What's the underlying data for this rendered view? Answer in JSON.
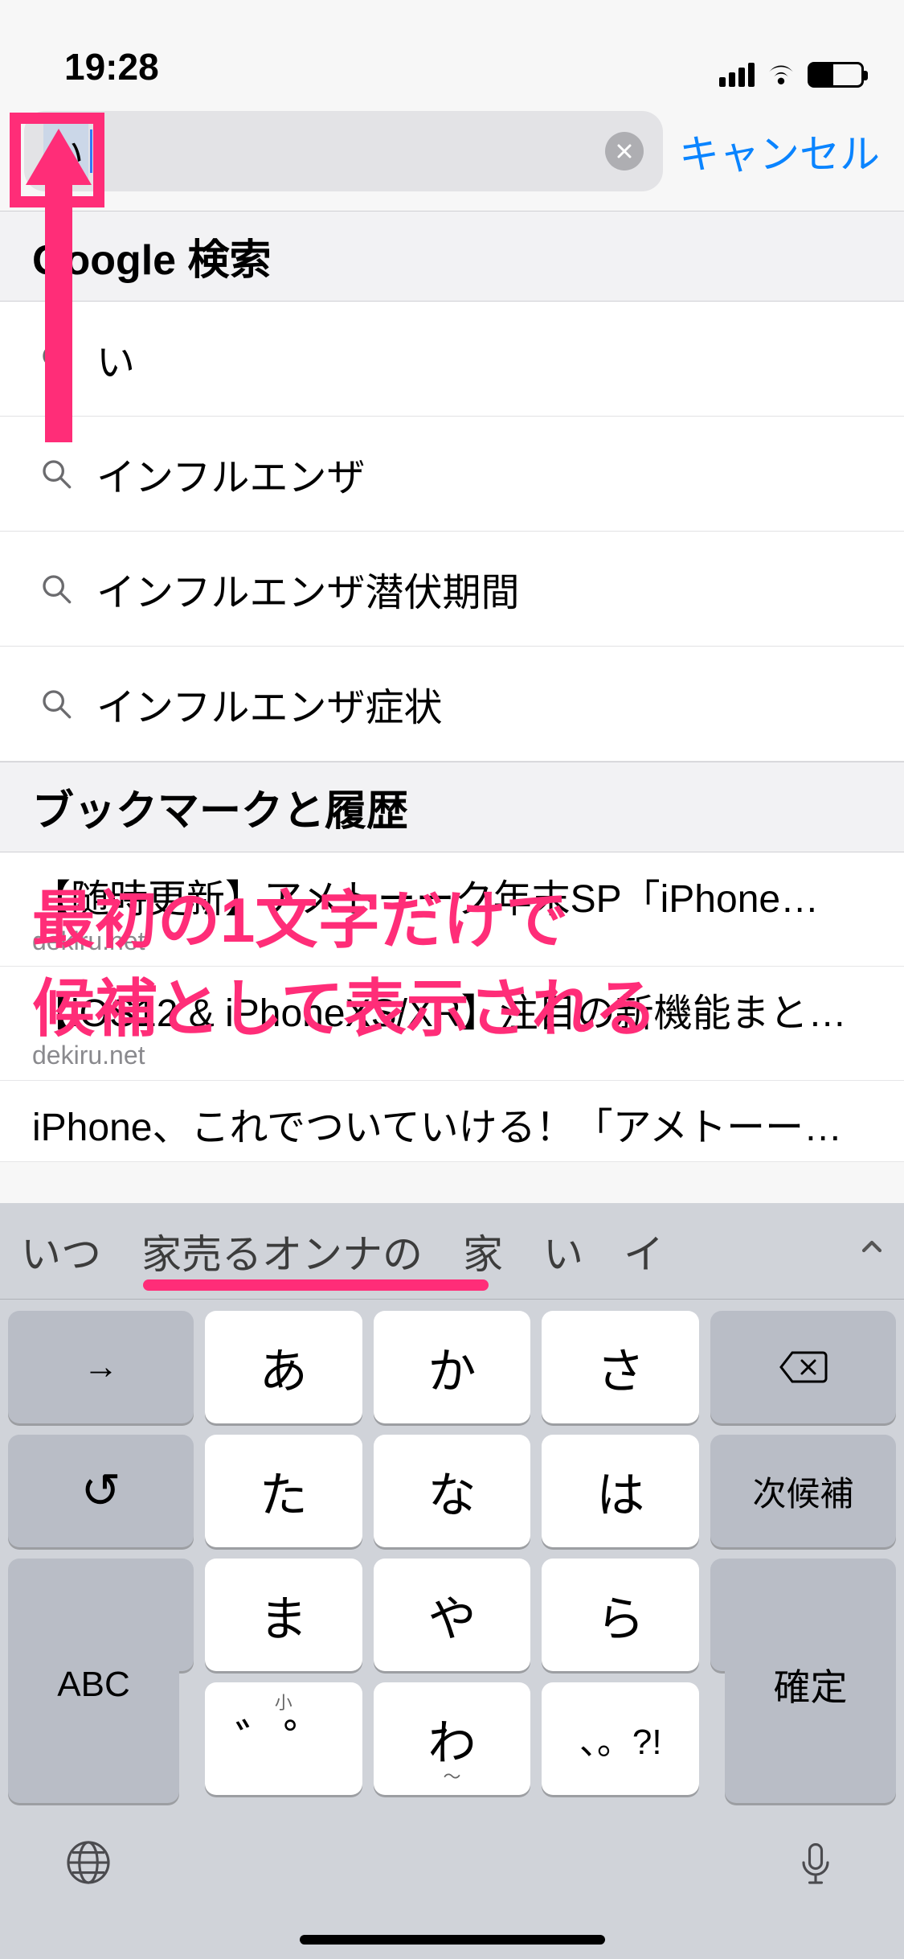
{
  "status": {
    "time": "19:28"
  },
  "search": {
    "value": "い",
    "cancel": "キャンセル"
  },
  "sections": {
    "google_header": "Google 検索",
    "history_header": "ブックマークと履歴"
  },
  "suggestions": [
    "い",
    "インフルエンザ",
    "インフルエンザ潜伏期間",
    "インフルエンザ症状"
  ],
  "history": [
    {
      "title": "【随時更新】アメトーーク年末SP「iPhone…",
      "sub": "dekiru.net"
    },
    {
      "title": "【iOS12 & iPhoneXS/XR】注目の新機能まと…",
      "sub": "dekiru.net"
    },
    {
      "title": "iPhone、これでついていける！「アメトーー…",
      "sub": ""
    }
  ],
  "candidates": [
    "いつ",
    "家売るオンナの",
    "家",
    "い",
    "イ"
  ],
  "keys": {
    "row1": [
      "あ",
      "か",
      "さ"
    ],
    "row2": [
      "た",
      "な",
      "は"
    ],
    "row3": [
      "ま",
      "や",
      "ら"
    ],
    "row4": [
      "゛゜",
      "わ",
      "、。?!"
    ],
    "next": "次候補",
    "confirm": "確定",
    "abc": "ABC",
    "small": "小",
    "arrow": "→",
    "undo": "↺"
  },
  "annotation": {
    "line1": "最初の1文字だけで",
    "line2": "候補として表示される"
  }
}
